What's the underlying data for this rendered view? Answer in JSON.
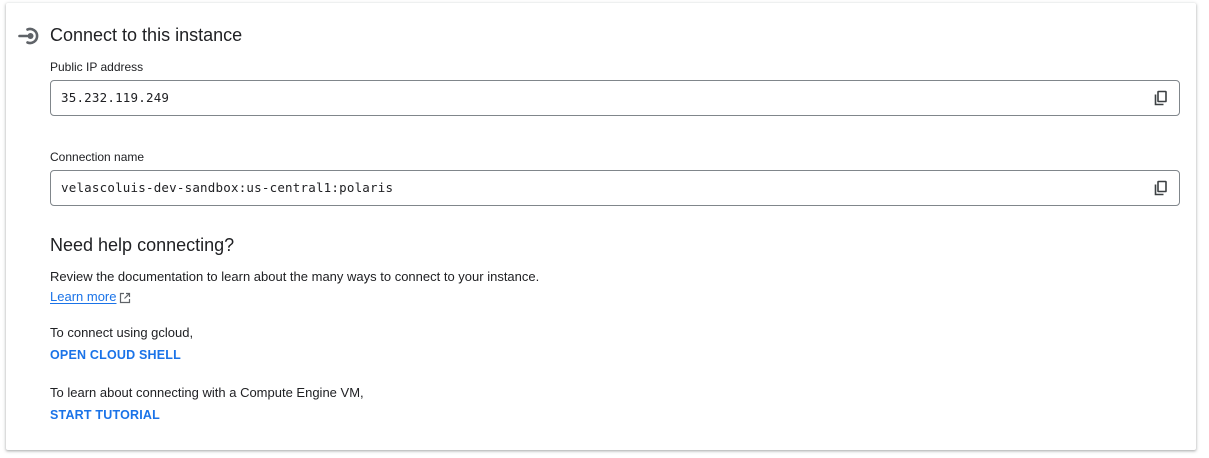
{
  "card": {
    "title": "Connect to this instance",
    "icon": "connect-icon"
  },
  "public_ip": {
    "label": "Public IP address",
    "value": "35.232.119.249",
    "copy_icon": "copy-icon"
  },
  "connection_name": {
    "label": "Connection name",
    "value": "velascoluis-dev-sandbox:us-central1:polaris",
    "copy_icon": "copy-icon"
  },
  "help": {
    "title": "Need help connecting?",
    "description": "Review the documentation to learn about the many ways to connect to your instance.",
    "learn_more_label": "Learn more",
    "learn_more_icon": "external-link-icon",
    "gcloud_text": "To connect using gcloud,",
    "gcloud_action": "OPEN CLOUD SHELL",
    "vm_text": "To learn about connecting with a Compute Engine VM,",
    "vm_action": "START TUTORIAL"
  },
  "colors": {
    "link": "#1a73e8",
    "text": "#202124",
    "border": "#80868b",
    "icon": "#5f6368"
  }
}
